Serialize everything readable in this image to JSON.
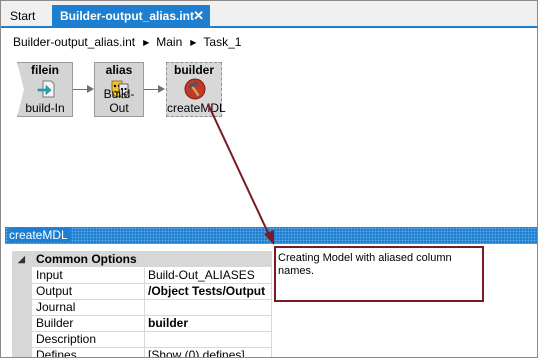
{
  "tabs": [
    {
      "label": "Start",
      "active": false
    },
    {
      "label": "Builder-output_alias.int",
      "active": true
    }
  ],
  "breadcrumb": [
    "Builder-output_alias.int",
    "Main",
    "Task_1"
  ],
  "nodes": {
    "filein": {
      "title": "filein",
      "label": "build-In",
      "icon": "arrow-into-file-icon"
    },
    "alias": {
      "title": "alias",
      "label": "Build-Out",
      "icon": "theatre-masks-icon"
    },
    "builder": {
      "title": "builder",
      "label": "createMDL",
      "icon": "hammer-icon"
    }
  },
  "panel": {
    "title": "createMDL",
    "group": "Common Options",
    "properties": [
      {
        "name": "Input",
        "value": "Build-Out_ALIASES"
      },
      {
        "name": "Output",
        "value": "/Object Tests/Output"
      },
      {
        "name": "Journal",
        "value": ""
      },
      {
        "name": "Builder",
        "value": "builder"
      },
      {
        "name": "Description",
        "value": ""
      },
      {
        "name": "Defines",
        "value": "[Show (0) defines]"
      }
    ],
    "description": "Creating Model with aliased column names."
  },
  "colors": {
    "accent": "#1e7fd0",
    "callout": "#7a1a24"
  }
}
